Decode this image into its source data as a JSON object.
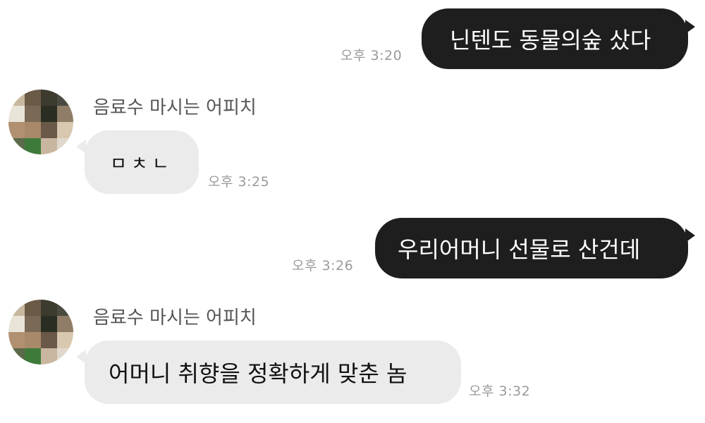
{
  "messages": [
    {
      "from": "me",
      "text": "닌텐도 동물의숲 샀다",
      "time": "오후 3:20"
    },
    {
      "from": "other",
      "sender": "음료수 마시는 어피치",
      "text": "ㅁㅊㄴ",
      "time": "오후 3:25"
    },
    {
      "from": "me",
      "text": "우리어머니 선물로 산건데",
      "time": "오후 3:26"
    },
    {
      "from": "other",
      "sender": "음료수 마시는 어피치",
      "text": "어머니 취향을 정확하게 맞춘 놈",
      "time": "오후 3:32"
    }
  ],
  "colors": {
    "my_bubble": "#1e1e1e",
    "other_bubble": "#ebebeb",
    "time_text": "#9a9a9a"
  },
  "avatar": {
    "icon": "pixelated-profile-avatar",
    "tiles": [
      "#c9b8a0",
      "#6b5a46",
      "#3d3a2e",
      "#4a4a40",
      "#e8e4d8",
      "#7a6a55",
      "#2a2e22",
      "#8f7d68",
      "#b09070",
      "#a88a6a",
      "#6a5848",
      "#d8c8b0",
      "#5a6a4a",
      "#3e7a3a",
      "#c8b6a0",
      "#e0d8cc"
    ]
  }
}
